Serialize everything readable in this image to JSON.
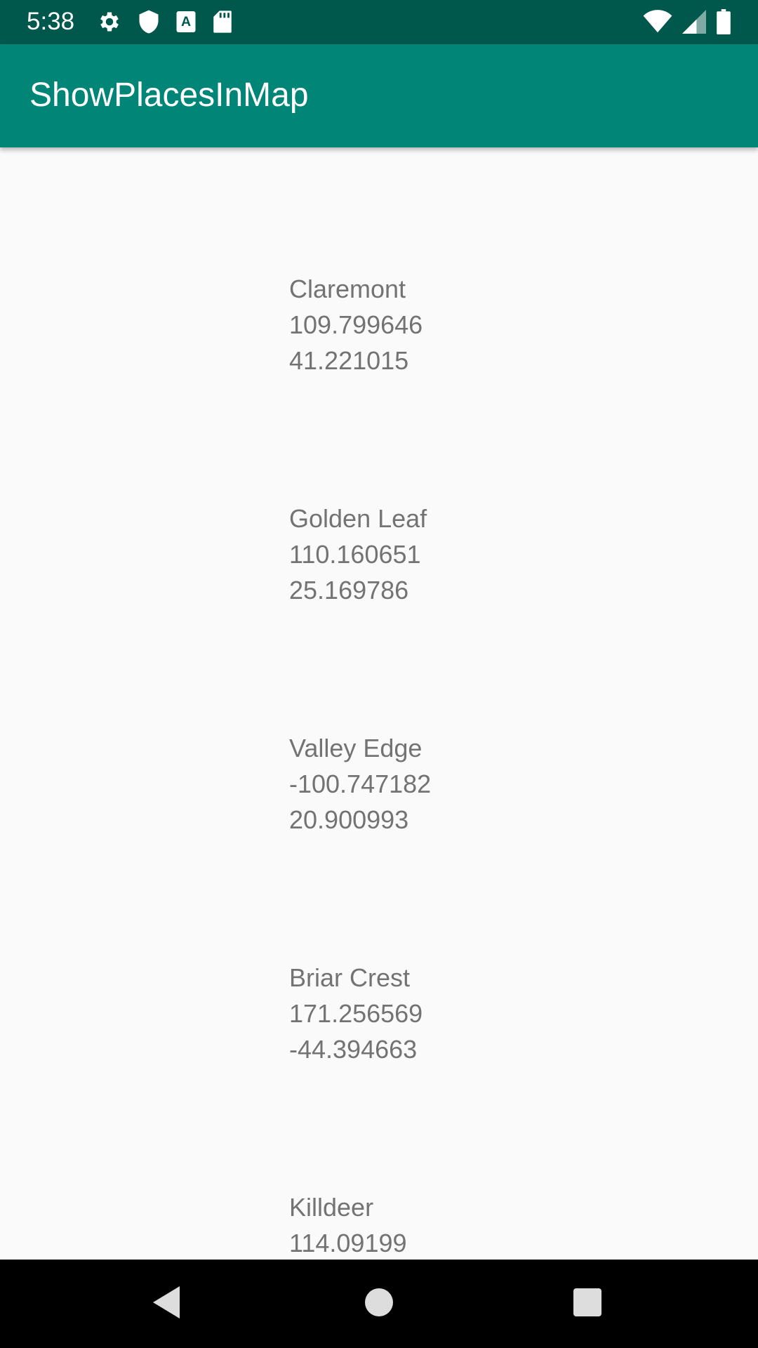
{
  "status_bar": {
    "time": "5:38",
    "left_icons": [
      "gear-icon",
      "shield-icon",
      "a-text-icon",
      "sd-card-icon"
    ],
    "right_icons": [
      "wifi-icon",
      "cell-signal-icon",
      "battery-icon"
    ]
  },
  "app_bar": {
    "title": "ShowPlacesInMap"
  },
  "places": [
    {
      "name": "Claremont",
      "lng": "109.799646",
      "lat": "41.221015"
    },
    {
      "name": "Golden Leaf",
      "lng": "110.160651",
      "lat": "25.169786"
    },
    {
      "name": "Valley Edge",
      "lng": "-100.747182",
      "lat": "20.900993"
    },
    {
      "name": "Briar Crest",
      "lng": "171.256569",
      "lat": "-44.394663"
    },
    {
      "name": "Killdeer",
      "lng": "114.09199",
      "lat": ""
    }
  ],
  "nav_bar": {
    "buttons": [
      "back-icon",
      "home-icon",
      "recents-icon"
    ]
  }
}
